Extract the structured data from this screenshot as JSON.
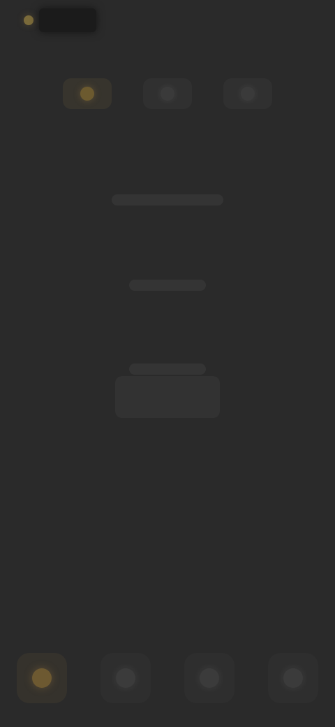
{
  "app": {
    "logo_text": ""
  },
  "top_tabs": [
    {
      "label": "",
      "icon": "home-icon"
    },
    {
      "label": "",
      "icon": "list-icon"
    },
    {
      "label": "",
      "icon": "settings-icon"
    }
  ],
  "stats": [
    {
      "label": "",
      "value": "",
      "unit": ""
    },
    {
      "label": "",
      "value": "",
      "unit": ""
    },
    {
      "label": "",
      "value": ""
    }
  ],
  "bottom_nav": [
    {
      "label": "",
      "icon": "home-icon"
    },
    {
      "label": "",
      "icon": "chart-icon"
    },
    {
      "label": "",
      "icon": "tasks-icon"
    },
    {
      "label": "",
      "icon": "profile-icon"
    }
  ],
  "colors": {
    "background": "#2a2a2a",
    "accent": "#6c5a2f"
  }
}
